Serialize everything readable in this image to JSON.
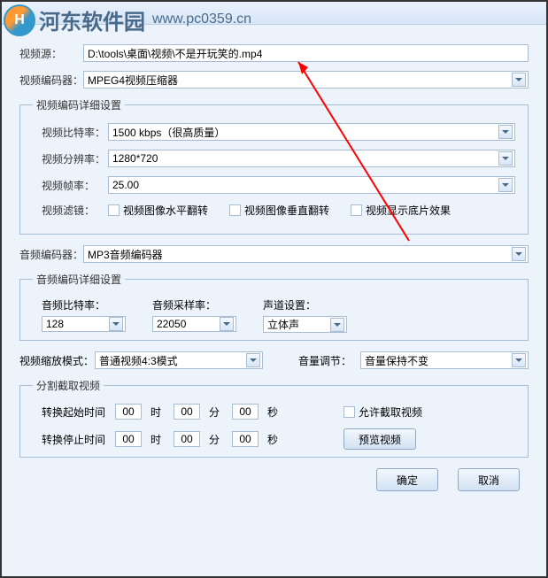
{
  "watermark": {
    "text": "河东软件园",
    "url": "www.pc0359.cn"
  },
  "source": {
    "label": "视频源：",
    "value": "D:\\tools\\桌面\\视频\\不是开玩笑的.mp4"
  },
  "videoEncoder": {
    "label": "视频编码器：",
    "value": "MPEG4视频压缩器"
  },
  "videoDetail": {
    "legend": "视频编码详细设置",
    "bitrate": {
      "label": "视频比特率：",
      "value": "1500 kbps（很高质量）"
    },
    "resolution": {
      "label": "视频分辨率：",
      "value": "1280*720"
    },
    "fps": {
      "label": "视频帧率：",
      "value": "25.00"
    },
    "filter": {
      "label": "视频滤镜：",
      "hflip": "视频图像水平翻转",
      "vflip": "视频图像垂直翻转",
      "negative": "视频显示底片效果"
    }
  },
  "audioEncoder": {
    "label": "音频编码器：",
    "value": "MP3音频编码器"
  },
  "audioDetail": {
    "legend": "音频编码详细设置",
    "bitrate": {
      "label": "音频比特率：",
      "value": "128"
    },
    "samplerate": {
      "label": "音频采样率：",
      "value": "22050"
    },
    "channel": {
      "label": "声道设置：",
      "value": "立体声"
    }
  },
  "scale": {
    "label": "视频缩放模式：",
    "value": "普通视频4:3模式"
  },
  "volume": {
    "label": "音量调节：",
    "value": "音量保持不变"
  },
  "split": {
    "legend": "分割截取视频",
    "startLabel": "转换起始时间",
    "stopLabel": "转换停止时间",
    "h": "时",
    "m": "分",
    "s": "秒",
    "hh": "00",
    "mm": "00",
    "ss": "00",
    "allowLabel": "允许截取视频",
    "previewBtn": "预览视频"
  },
  "buttons": {
    "ok": "确定",
    "cancel": "取消"
  }
}
